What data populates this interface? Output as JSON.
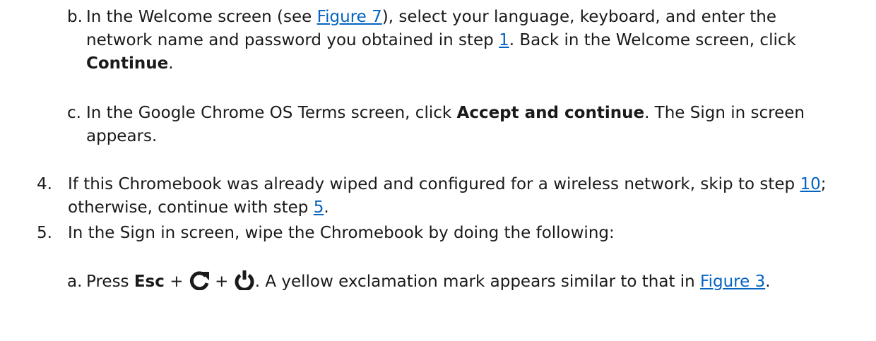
{
  "items": {
    "b": {
      "marker": "b.",
      "t1": "In the Welcome screen (see ",
      "link1": "Figure 7",
      "t2": "), select your language, keyboard, and enter the network name and password you obtained in step ",
      "link2": "1",
      "t3": ". Back in the Welcome screen, click ",
      "bold": "Continue",
      "t4": "."
    },
    "c": {
      "marker": "c.",
      "t1": "In the Google Chrome OS Terms screen, click ",
      "bold": "Accept and continue",
      "t2": ". The Sign in screen appears."
    },
    "four": {
      "marker": "4.",
      "t1": "If this Chromebook was already wiped and configured for a wireless network, skip to step ",
      "link1": "10",
      "t2": "; otherwise, continue with step ",
      "link2": "5",
      "t3": "."
    },
    "five": {
      "marker": "5.",
      "t1": "In the Sign in screen, wipe the Chromebook by doing the following:"
    },
    "a": {
      "marker": "a.",
      "t1": "Press ",
      "bold": "Esc",
      "plus1": " + ",
      "refresh_icon": "refresh-icon",
      "plus2": " + ",
      "power_icon": "power-icon",
      "t2": ". A yellow exclamation mark appears similar to that in ",
      "link1": "Figure 3",
      "t3": "."
    }
  },
  "colors": {
    "text": "#1a1a1a",
    "link": "#0563c1"
  }
}
